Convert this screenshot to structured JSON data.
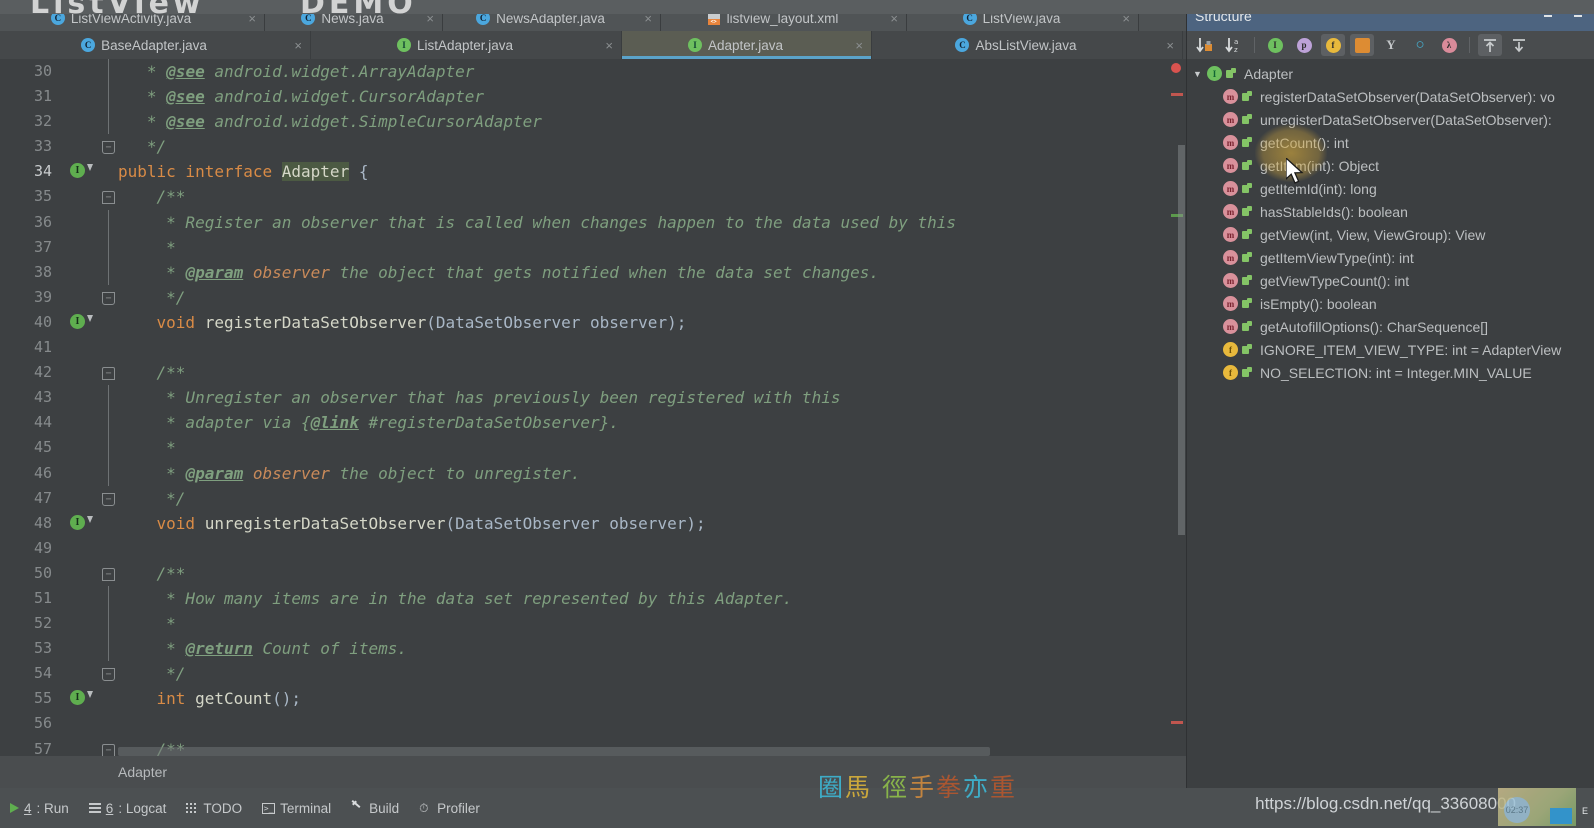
{
  "window": {
    "top_watermark_left": "ListView",
    "top_watermark_right": "DEMO"
  },
  "tabs_row1": [
    {
      "label": "ListViewActivity.java",
      "icon": "java-class-icon",
      "kind": "cls",
      "close": "×",
      "active": false
    },
    {
      "label": "News.java",
      "icon": "java-class-icon",
      "kind": "cls",
      "close": "×",
      "active": false
    },
    {
      "label": "NewsAdapter.java",
      "icon": "java-class-icon",
      "kind": "cls",
      "close": "×",
      "active": false
    },
    {
      "label": "listview_layout.xml",
      "icon": "xml-layout-icon",
      "kind": "xml",
      "close": "×",
      "active": false
    },
    {
      "label": "ListView.java",
      "icon": "java-class-icon",
      "kind": "cls",
      "close": "×",
      "active": false
    }
  ],
  "tabs_row2": [
    {
      "label": "BaseAdapter.java",
      "icon": "java-class-icon",
      "kind": "cls",
      "close": "×",
      "active": false
    },
    {
      "label": "ListAdapter.java",
      "icon": "java-interface-icon",
      "kind": "iface",
      "close": "×",
      "active": false
    },
    {
      "label": "Adapter.java",
      "icon": "java-interface-icon",
      "kind": "iface",
      "close": "×",
      "active": true
    },
    {
      "label": "AbsListView.java",
      "icon": "java-class-icon",
      "kind": "cls",
      "close": "×",
      "active": false
    }
  ],
  "editor": {
    "breadcrumb": "Adapter",
    "first_line": 30,
    "lines": [
      {
        "n": 30,
        "fold": "",
        "gutter": false,
        "segments": [
          {
            "t": "   * ",
            "c": "cm"
          },
          {
            "t": "@see",
            "c": "tag"
          },
          {
            "t": " android.widget.ArrayAdapter",
            "c": "cm"
          }
        ]
      },
      {
        "n": 31,
        "fold": "",
        "gutter": false,
        "segments": [
          {
            "t": "   * ",
            "c": "cm"
          },
          {
            "t": "@see",
            "c": "tag"
          },
          {
            "t": " android.widget.CursorAdapter",
            "c": "cm"
          }
        ]
      },
      {
        "n": 32,
        "fold": "",
        "gutter": false,
        "segments": [
          {
            "t": "   * ",
            "c": "cm"
          },
          {
            "t": "@see",
            "c": "tag"
          },
          {
            "t": " android.widget.SimpleCursorAdapter",
            "c": "cm"
          }
        ]
      },
      {
        "n": 33,
        "fold": "bot",
        "gutter": false,
        "segments": [
          {
            "t": "   */",
            "c": "cm"
          }
        ]
      },
      {
        "n": 34,
        "fold": "",
        "gutter": true,
        "cur": true,
        "segments": [
          {
            "t": "public interface ",
            "c": "kw"
          },
          {
            "t": "Adapter",
            "c": "idn hl"
          },
          {
            "t": " {",
            "c": "typ"
          }
        ]
      },
      {
        "n": 35,
        "fold": "top",
        "gutter": false,
        "segments": [
          {
            "t": "    /**",
            "c": "cm"
          }
        ]
      },
      {
        "n": 36,
        "fold": "",
        "gutter": false,
        "segments": [
          {
            "t": "     * Register an observer that is called when changes happen to the data used by this",
            "c": "cm"
          }
        ]
      },
      {
        "n": 37,
        "fold": "",
        "gutter": false,
        "segments": [
          {
            "t": "     *",
            "c": "cm"
          }
        ]
      },
      {
        "n": 38,
        "fold": "",
        "gutter": false,
        "segments": [
          {
            "t": "     * ",
            "c": "cm"
          },
          {
            "t": "@param",
            "c": "tag"
          },
          {
            "t": " observer",
            "c": "pname"
          },
          {
            "t": " the object that gets notified when the data set changes.",
            "c": "cm"
          }
        ]
      },
      {
        "n": 39,
        "fold": "bot",
        "gutter": false,
        "segments": [
          {
            "t": "     */",
            "c": "cm"
          }
        ]
      },
      {
        "n": 40,
        "fold": "",
        "gutter": true,
        "segments": [
          {
            "t": "    ",
            "c": "typ"
          },
          {
            "t": "void",
            "c": "kw"
          },
          {
            "t": " registerDataSetObserver",
            "c": "idn"
          },
          {
            "t": "(DataSetObserver observer);",
            "c": "typ"
          }
        ]
      },
      {
        "n": 41,
        "fold": "",
        "gutter": false,
        "segments": [
          {
            "t": "",
            "c": "typ"
          }
        ]
      },
      {
        "n": 42,
        "fold": "top",
        "gutter": false,
        "segments": [
          {
            "t": "    /**",
            "c": "cm"
          }
        ]
      },
      {
        "n": 43,
        "fold": "",
        "gutter": false,
        "segments": [
          {
            "t": "     * Unregister an observer that has previously been registered with this",
            "c": "cm"
          }
        ]
      },
      {
        "n": 44,
        "fold": "",
        "gutter": false,
        "segments": [
          {
            "t": "     * adapter via {",
            "c": "cm"
          },
          {
            "t": "@link",
            "c": "tag"
          },
          {
            "t": " #registerDataSetObserver}.",
            "c": "cm"
          }
        ]
      },
      {
        "n": 45,
        "fold": "",
        "gutter": false,
        "segments": [
          {
            "t": "     *",
            "c": "cm"
          }
        ]
      },
      {
        "n": 46,
        "fold": "",
        "gutter": false,
        "segments": [
          {
            "t": "     * ",
            "c": "cm"
          },
          {
            "t": "@param",
            "c": "tag"
          },
          {
            "t": " observer",
            "c": "pname"
          },
          {
            "t": " the object to unregister.",
            "c": "cm"
          }
        ]
      },
      {
        "n": 47,
        "fold": "bot",
        "gutter": false,
        "segments": [
          {
            "t": "     */",
            "c": "cm"
          }
        ]
      },
      {
        "n": 48,
        "fold": "",
        "gutter": true,
        "segments": [
          {
            "t": "    ",
            "c": "typ"
          },
          {
            "t": "void",
            "c": "kw"
          },
          {
            "t": " unregisterDataSetObserver",
            "c": "idn"
          },
          {
            "t": "(DataSetObserver observer);",
            "c": "typ"
          }
        ]
      },
      {
        "n": 49,
        "fold": "",
        "gutter": false,
        "segments": [
          {
            "t": "",
            "c": "typ"
          }
        ]
      },
      {
        "n": 50,
        "fold": "top",
        "gutter": false,
        "segments": [
          {
            "t": "    /**",
            "c": "cm"
          }
        ]
      },
      {
        "n": 51,
        "fold": "",
        "gutter": false,
        "segments": [
          {
            "t": "     * How many items are in the data set represented by this Adapter.",
            "c": "cm"
          }
        ]
      },
      {
        "n": 52,
        "fold": "",
        "gutter": false,
        "segments": [
          {
            "t": "     *",
            "c": "cm"
          }
        ]
      },
      {
        "n": 53,
        "fold": "",
        "gutter": false,
        "segments": [
          {
            "t": "     * ",
            "c": "cm"
          },
          {
            "t": "@return",
            "c": "tag"
          },
          {
            "t": " Count of items.",
            "c": "cm"
          }
        ]
      },
      {
        "n": 54,
        "fold": "bot",
        "gutter": false,
        "segments": [
          {
            "t": "     */",
            "c": "cm"
          }
        ]
      },
      {
        "n": 55,
        "fold": "",
        "gutter": true,
        "segments": [
          {
            "t": "    ",
            "c": "typ"
          },
          {
            "t": "int",
            "c": "kw"
          },
          {
            "t": " getCount",
            "c": "idn"
          },
          {
            "t": "();",
            "c": "typ"
          }
        ]
      },
      {
        "n": 56,
        "fold": "",
        "gutter": false,
        "segments": [
          {
            "t": "",
            "c": "typ"
          }
        ]
      },
      {
        "n": 57,
        "fold": "top",
        "gutter": false,
        "segments": [
          {
            "t": "    /**",
            "c": "cm"
          }
        ]
      }
    ]
  },
  "structure": {
    "title": "Structure",
    "header_icons": [
      {
        "name": "expand-all-icon"
      },
      {
        "name": "collapse-all-icon"
      }
    ],
    "toolbar": [
      {
        "name": "sort-by-visibility-button",
        "glyph": "↓",
        "sub": "■",
        "kind": "sort-vis",
        "pressed": false
      },
      {
        "name": "sort-alphabetically-button",
        "glyph": "↓",
        "sub": "az",
        "kind": "sort-az",
        "pressed": false
      },
      {
        "name": "show-inherited-button",
        "kind": "badge",
        "badge": "b-green",
        "text": "I",
        "pressed": false
      },
      {
        "name": "show-properties-button",
        "kind": "badge",
        "badge": "b-purple",
        "text": "p",
        "pressed": false
      },
      {
        "name": "show-fields-button",
        "kind": "badge",
        "badge": "b-yellow",
        "text": "f",
        "pressed": true
      },
      {
        "name": "show-non-public-button",
        "kind": "badge",
        "badge": "b-orange",
        "text": "",
        "pressed": true
      },
      {
        "name": "show-anonymous-classes-button",
        "kind": "badge",
        "badge": "b-grey",
        "text": "Υ",
        "pressed": false
      },
      {
        "name": "show-interfaces-button",
        "kind": "badge",
        "badge": "b-cyan",
        "text": "○",
        "pressed": false
      },
      {
        "name": "show-lambdas-button",
        "kind": "badge",
        "badge": "b-pink",
        "text": "λ",
        "pressed": false
      },
      {
        "name": "expand-all-button",
        "kind": "arrow-up",
        "pressed": true
      },
      {
        "name": "collapse-all-button",
        "kind": "arrow-down",
        "pressed": false
      }
    ],
    "tree": [
      {
        "label": "Adapter",
        "kind": "iface",
        "level": 0,
        "caret": "▼"
      },
      {
        "label": "registerDataSetObserver(DataSetObserver): vo",
        "kind": "method",
        "level": 1
      },
      {
        "label": "unregisterDataSetObserver(DataSetObserver):",
        "kind": "method",
        "level": 1
      },
      {
        "label": "getCount(): int",
        "kind": "method",
        "level": 1
      },
      {
        "label": "getItem(int): Object",
        "kind": "method",
        "level": 1
      },
      {
        "label": "getItemId(int): long",
        "kind": "method",
        "level": 1
      },
      {
        "label": "hasStableIds(): boolean",
        "kind": "method",
        "level": 1
      },
      {
        "label": "getView(int, View, ViewGroup): View",
        "kind": "method",
        "level": 1
      },
      {
        "label": "getItemViewType(int): int",
        "kind": "method",
        "level": 1
      },
      {
        "label": "getViewTypeCount(): int",
        "kind": "method",
        "level": 1
      },
      {
        "label": "isEmpty(): boolean",
        "kind": "method",
        "level": 1
      },
      {
        "label": "getAutofillOptions(): CharSequence[]",
        "kind": "method",
        "level": 1
      },
      {
        "label": "IGNORE_ITEM_VIEW_TYPE: int = AdapterView",
        "kind": "field",
        "level": 1
      },
      {
        "label": "NO_SELECTION: int = Integer.MIN_VALUE",
        "kind": "field",
        "level": 1
      }
    ]
  },
  "statusbar": [
    {
      "num": "4",
      "label": ": Run",
      "icon": "run-icon"
    },
    {
      "num": "6",
      "label": ": Logcat",
      "icon": "logcat-icon"
    },
    {
      "num": "",
      "label": "TODO",
      "icon": "todo-icon"
    },
    {
      "num": "",
      "label": "Terminal",
      "icon": "terminal-icon"
    },
    {
      "num": "",
      "label": "Build",
      "icon": "build-icon"
    },
    {
      "num": "",
      "label": "Profiler",
      "icon": "profiler-icon"
    }
  ],
  "watermarks": {
    "url": "https://blog.csdn.net/qq_33608000",
    "cjk": [
      "圈",
      "馬",
      " ",
      "徑",
      "手",
      "拳",
      "亦",
      "重"
    ],
    "tray_time": "02:37",
    "tray_letter": "E"
  },
  "colors": {
    "accent_tab": "#5ba3c9",
    "panel_header": "#4d6480",
    "editor_bg": "#3d4042",
    "comment": "#7f9f7f",
    "keyword": "#d98b46",
    "error": "#cc4b4b"
  }
}
